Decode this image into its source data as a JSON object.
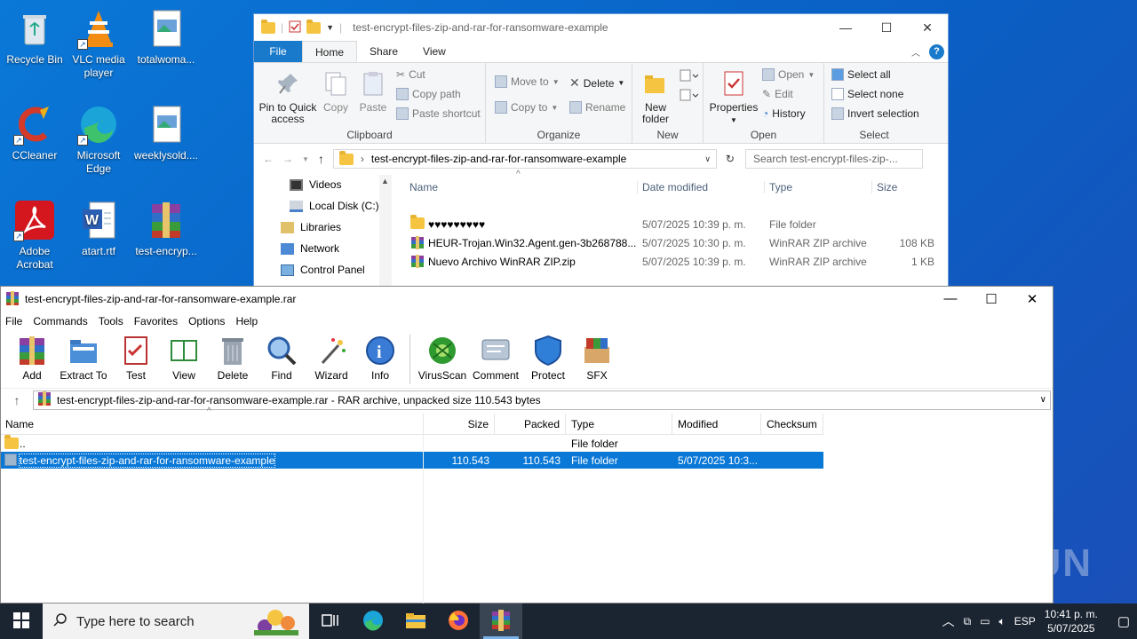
{
  "desktop": {
    "icons": [
      {
        "label": "Recycle Bin"
      },
      {
        "label": "VLC media player"
      },
      {
        "label": "totalwoma..."
      },
      {
        "label": "CCleaner"
      },
      {
        "label": "Microsoft Edge"
      },
      {
        "label": "weeklysold...."
      },
      {
        "label": "Adobe Acrobat"
      },
      {
        "label": "atart.rtf"
      },
      {
        "label": "test-encryp..."
      }
    ],
    "watermark": "ANY RUN"
  },
  "explorer": {
    "title": "test-encrypt-files-zip-and-rar-for-ransomware-example",
    "tabs": {
      "file": "File",
      "home": "Home",
      "share": "Share",
      "view": "View"
    },
    "ribbon": {
      "pin": "Pin to Quick access",
      "copy": "Copy",
      "paste": "Paste",
      "cut": "Cut",
      "copy_path": "Copy path",
      "paste_shortcut": "Paste shortcut",
      "clipboard": "Clipboard",
      "move_to": "Move to",
      "copy_to": "Copy to",
      "delete": "Delete",
      "rename": "Rename",
      "organize": "Organize",
      "new_folder": "New folder",
      "new": "New",
      "properties": "Properties",
      "open": "Open",
      "edit": "Edit",
      "history": "History",
      "open_group": "Open",
      "select_all": "Select all",
      "select_none": "Select none",
      "invert_selection": "Invert selection",
      "select": "Select"
    },
    "address": "test-encrypt-files-zip-and-rar-for-ransomware-example",
    "search_placeholder": "Search test-encrypt-files-zip-...",
    "nav": [
      {
        "label": "Videos"
      },
      {
        "label": "Local Disk (C:)"
      },
      {
        "label": "Libraries"
      },
      {
        "label": "Network"
      },
      {
        "label": "Control Panel"
      }
    ],
    "columns": {
      "name": "Name",
      "date": "Date modified",
      "type": "Type",
      "size": "Size"
    },
    "files": [
      {
        "name": "♥♥♥♥♥♥♥♥♥",
        "date": "5/07/2025 10:39 p. m.",
        "type": "File folder",
        "size": ""
      },
      {
        "name": "HEUR-Trojan.Win32.Agent.gen-3b268788...",
        "date": "5/07/2025 10:30 p. m.",
        "type": "WinRAR ZIP archive",
        "size": "108 KB"
      },
      {
        "name": "Nuevo Archivo WinRAR ZIP.zip",
        "date": "5/07/2025 10:39 p. m.",
        "type": "WinRAR ZIP archive",
        "size": "1 KB"
      }
    ]
  },
  "winrar": {
    "title": "test-encrypt-files-zip-and-rar-for-ransomware-example.rar",
    "menu": [
      "File",
      "Commands",
      "Tools",
      "Favorites",
      "Options",
      "Help"
    ],
    "tools": [
      {
        "label": "Add"
      },
      {
        "label": "Extract To"
      },
      {
        "label": "Test"
      },
      {
        "label": "View"
      },
      {
        "label": "Delete"
      },
      {
        "label": "Find"
      },
      {
        "label": "Wizard"
      },
      {
        "label": "Info"
      },
      {
        "label": "VirusScan"
      },
      {
        "label": "Comment"
      },
      {
        "label": "Protect"
      },
      {
        "label": "SFX"
      }
    ],
    "path": "test-encrypt-files-zip-and-rar-for-ransomware-example.rar - RAR archive, unpacked size 110.543 bytes",
    "columns": {
      "name": "Name",
      "size": "Size",
      "packed": "Packed",
      "type": "Type",
      "modified": "Modified",
      "checksum": "Checksum"
    },
    "rows": [
      {
        "name": "..",
        "size": "",
        "packed": "",
        "type": "File folder",
        "modified": ""
      },
      {
        "name": "test-encrypt-files-zip-and-rar-for-ransomware-example",
        "size": "110.543",
        "packed": "110.543",
        "type": "File folder",
        "modified": "5/07/2025 10:3..."
      }
    ]
  },
  "taskbar": {
    "search_placeholder": "Type here to search",
    "lang": "ESP",
    "time": "10:41 p. m.",
    "date": "5/07/2025"
  }
}
